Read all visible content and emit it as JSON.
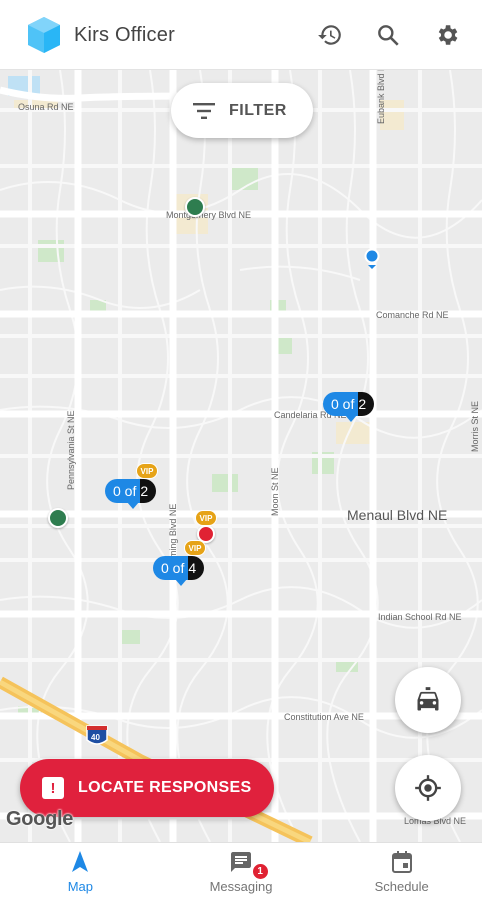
{
  "header": {
    "app_title": "Kirs Officer",
    "logo_icon": "hexagon-shield-icon",
    "logo_color": "#4fc3f7",
    "actions": [
      "history-icon",
      "search-icon",
      "settings-icon"
    ]
  },
  "map": {
    "filter_label": "FILTER",
    "filter_icon": "filter-list-icon",
    "streets": {
      "osuna": "Osuna Rd NE",
      "eubank": "Eubank Blvd NE",
      "montgomery": "Montgomery Blvd NE",
      "comanche": "Comanche Rd NE",
      "candelaria": "Candelaria Rd NE",
      "pennsylvania": "Pennsylvania St NE",
      "moon": "Moon St NE",
      "morris": "Morris St NE",
      "menaul": "Menaul Blvd NE",
      "indian_school": "Indian School Rd NE",
      "constitution": "Constitution Ave NE",
      "lomas": "Lomas Blvd NE",
      "wyoming": "Wyoming Blvd NE",
      "i40": "40"
    },
    "clusters": [
      {
        "count": "0 of",
        "total": "2"
      },
      {
        "count": "0 of",
        "total": "2"
      },
      {
        "count": "0 of",
        "total": "4"
      }
    ],
    "vip_label": "VIP",
    "status_colors": {
      "green": "#2e7d4f",
      "red": "#e02233",
      "vip": "#e6a317",
      "cluster_blue": "#1e88e5"
    },
    "locate_label": "LOCATE RESPONSES",
    "attribution": "Google"
  },
  "nav": {
    "items": [
      {
        "label": "Map",
        "icon": "navigation-arrow-icon",
        "active": true
      },
      {
        "label": "Messaging",
        "icon": "message-icon",
        "badge": "1"
      },
      {
        "label": "Schedule",
        "icon": "calendar-icon"
      }
    ]
  }
}
